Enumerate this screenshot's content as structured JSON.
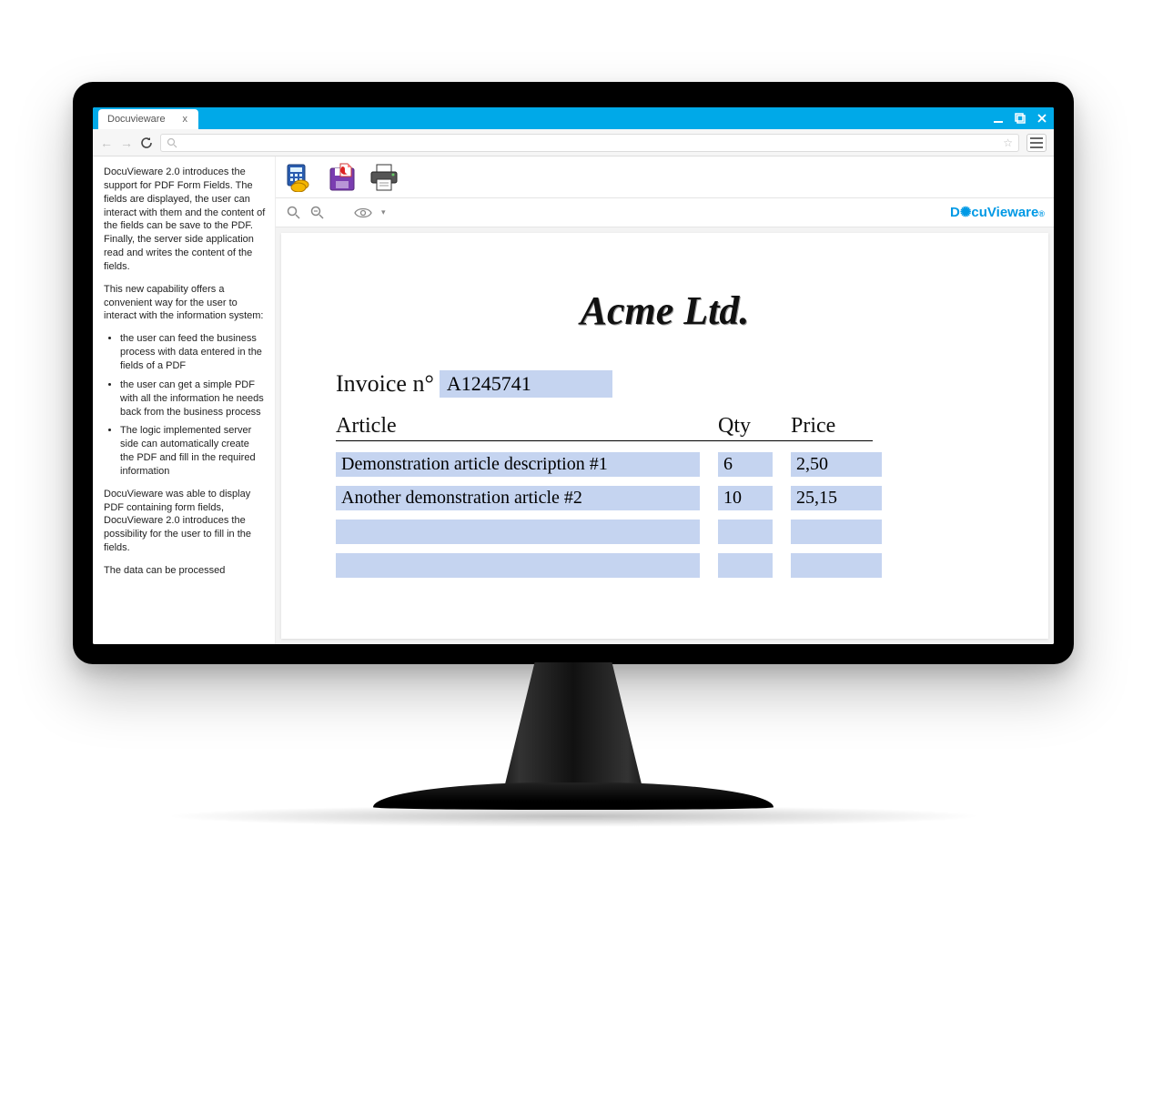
{
  "browser": {
    "tab_title": "Docuvieware",
    "tab_close": "x",
    "address_placeholder": ""
  },
  "sidebar": {
    "p1": "DocuVieware 2.0 introduces the support for PDF Form Fields. The fields are displayed, the user can interact with them and the content of the fields can be save to the PDF. Finally, the server side application read and writes the content of the fields.",
    "p2": "This new capability offers a convenient way for the user to interact with the information system:",
    "b1": "the user can feed the business process with data entered in the fields of a PDF",
    "b2": "the user can get a simple PDF with all the information he needs back from the business process",
    "b3": "The logic implemented server side can automatically create the PDF and fill in the required information",
    "p3": "DocuVieware was able to display PDF containing form fields, DocuVieware 2.0 introduces the possibility for the user to fill in the fields.",
    "p4": "The data can be processed"
  },
  "viewer": {
    "brand": "DocuVieware"
  },
  "document": {
    "company_name": "Acme Ltd.",
    "invoice_label": "Invoice n°",
    "invoice_number": "A1245741",
    "columns": {
      "article": "Article",
      "qty": "Qty",
      "price": "Price"
    },
    "rows": [
      {
        "article": "Demonstration article description #1",
        "qty": "6",
        "price": "2,50"
      },
      {
        "article": "Another demonstration article #2",
        "qty": "10",
        "price": "25,15"
      },
      {
        "article": "",
        "qty": "",
        "price": ""
      },
      {
        "article": "",
        "qty": "",
        "price": ""
      }
    ]
  }
}
